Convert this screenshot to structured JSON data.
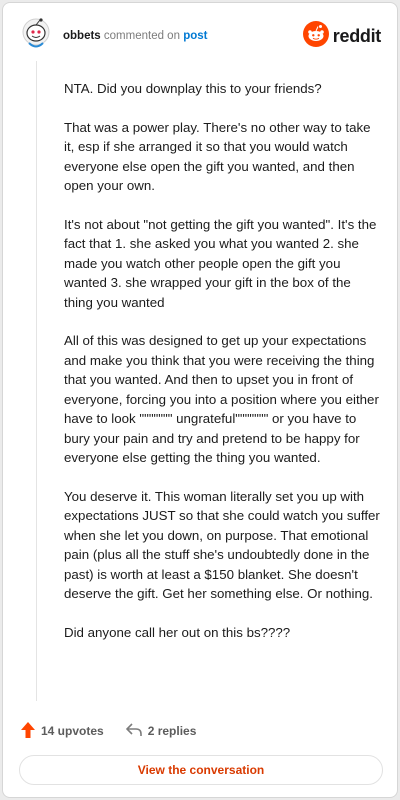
{
  "header": {
    "username": "obbets",
    "action_text": "commented on",
    "post_link": "post",
    "logo_text": "reddit"
  },
  "comment": {
    "paragraphs": [
      "NTA. Did you downplay this to your friends?",
      "That was a power play. There's no other way to take it, esp if she arranged it so that you would watch everyone else open the gift you wanted, and then open your own.",
      "It's not about \"not getting the gift you wanted\". It's the fact that 1. she asked you what you wanted 2. she made you watch other people open the gift you wanted 3. she wrapped your gift in the box of the thing you wanted",
      "All of this was designed to get up your expectations and make you think that you were receiving the thing that you wanted. And then to upset you in front of everyone, forcing you into a position where you either have to look \"\"\"\"\"\"\" ungrateful\"\"\"\"\"\"\" or you have to bury your pain and try and pretend to be happy for everyone else getting the thing you wanted.",
      "You deserve it. This woman literally set you up with expectations JUST so that she could watch you suffer when she let you down, on purpose. That emotional pain (plus all the stuff she's undoubtedly done in the past) is worth at least a $150 blanket. She doesn't deserve the gift. Get her something else. Or nothing.",
      "Did anyone call her out on this bs????"
    ]
  },
  "footer": {
    "upvotes": "14 upvotes",
    "replies": "2 replies",
    "view_button": "View the conversation"
  },
  "icons": {
    "avatar": "snoo-avatar-icon",
    "logo": "reddit-logo-icon",
    "upvote": "upvote-arrow-icon",
    "reply": "reply-arrow-icon"
  },
  "colors": {
    "brand": "#ff4500",
    "link": "#0079d3",
    "view_button_text": "#d93a00"
  }
}
